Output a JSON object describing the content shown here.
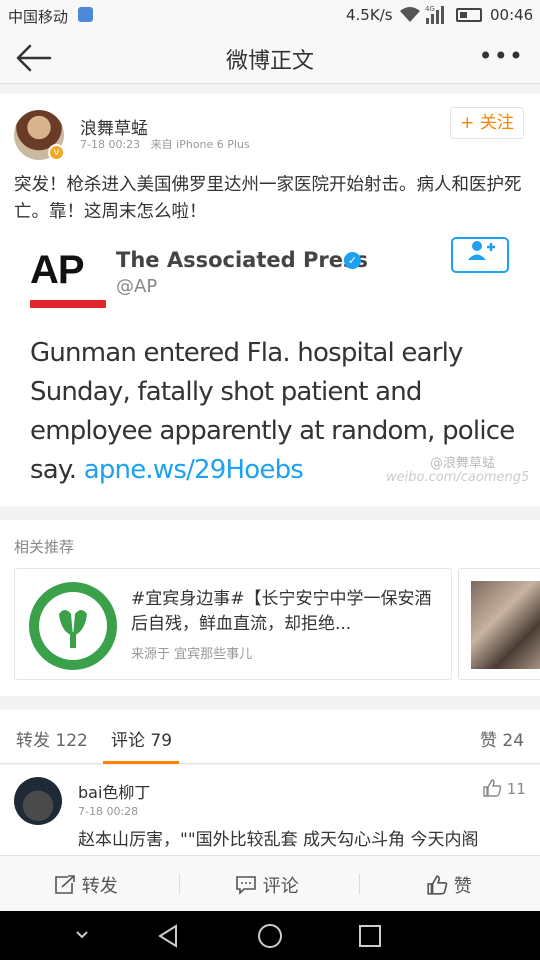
{
  "status_bar": {
    "carrier": "中国移动",
    "speed": "4.5K/s",
    "network": "4G",
    "time": "00:46"
  },
  "navbar": {
    "title": "微博正文",
    "more": "•••"
  },
  "post": {
    "username": "浪舞草蜢",
    "date": "7-18 00:23",
    "source": "来自 iPhone 6 Plus",
    "follow_label": "+ 关注",
    "text": "突发！枪杀进入美国佛罗里达州一家医院开始射击。病人和医护死亡。靠！这周末怎么啦！",
    "embed": {
      "logo_text": "AP",
      "account_name": "The Associated Press",
      "handle": "@AP",
      "tweet_text": "Gunman entered Fla. hospital early Sunday, fatally shot patient and employee apparently at random, police say. ",
      "tweet_link": "apne.ws/29Hoebs",
      "watermark": "@浪舞草蜢",
      "watermark_url": "weibo.com/caomeng5"
    }
  },
  "related": {
    "title": "相关推荐",
    "card_text": "#宜宾身边事#【长宁安宁中学一保安酒后自残，鲜血直流，却拒绝...",
    "card_source": "来源于 宜宾那些事儿",
    "card_logo_text": "宜宾那些事儿"
  },
  "tabs": {
    "repost": "转发 122",
    "comment": "评论 79",
    "like": "赞 24"
  },
  "comment": {
    "username": "bai色柳丁",
    "time": "7-18 00:28",
    "likes": "11",
    "text": "赵本山厉害，\"\"国外比较乱套 成天勾心斗角 今天内阁"
  },
  "toolbar": {
    "repost": "转发",
    "comment": "评论",
    "like": "赞"
  },
  "colors": {
    "accent": "#ff8200",
    "link": "#1da1f2",
    "ap_red": "#e0252b"
  }
}
